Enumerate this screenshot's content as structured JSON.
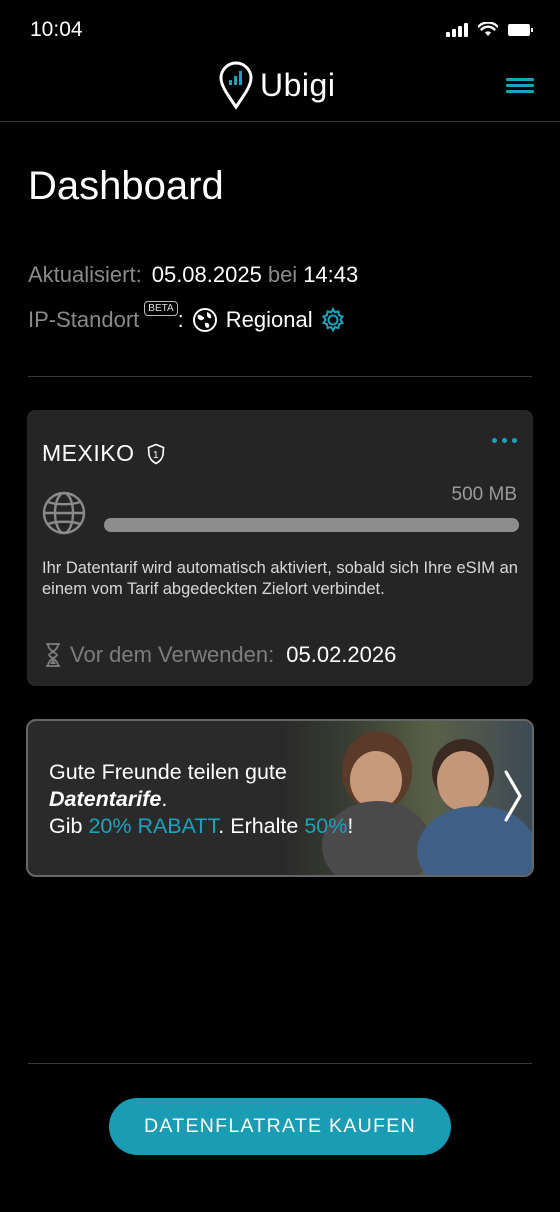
{
  "status_bar": {
    "time": "10:04"
  },
  "header": {
    "brand": "Ubigi"
  },
  "page": {
    "title": "Dashboard"
  },
  "updated": {
    "label": "Aktualisiert:",
    "date": "05.08.2025",
    "connector": "bei",
    "time": "14:43"
  },
  "ip_location": {
    "label": "IP-Standort",
    "badge": "BETA",
    "colon": ":",
    "value": "Regional"
  },
  "plan": {
    "country": "MEXIKO",
    "shield_number": "1",
    "data_amount": "500 MB",
    "used_fraction": 1.0,
    "note": "Ihr Datentarif wird automatisch aktiviert, sobald sich Ihre eSIM an einem vom Tarif abgedeckten Zielort verbindet.",
    "validity_label": "Vor dem Verwenden:",
    "validity_date": "05.02.2026"
  },
  "promo": {
    "line1_a": "Gute Freunde teilen ",
    "line1_b": "gute",
    "line2": "Datentarife",
    "line2_end": ".",
    "line3_a": "Gib ",
    "line3_discount": "20% RABATT",
    "line3_b": ". Erhalte ",
    "line3_reward": "50%",
    "line3_end": "!"
  },
  "cta": {
    "label": "DATENFLATRATE KAUFEN"
  },
  "colors": {
    "accent": "#1aa3bd",
    "background": "#000000",
    "card": "#252525",
    "button": "#1a9cb5"
  }
}
